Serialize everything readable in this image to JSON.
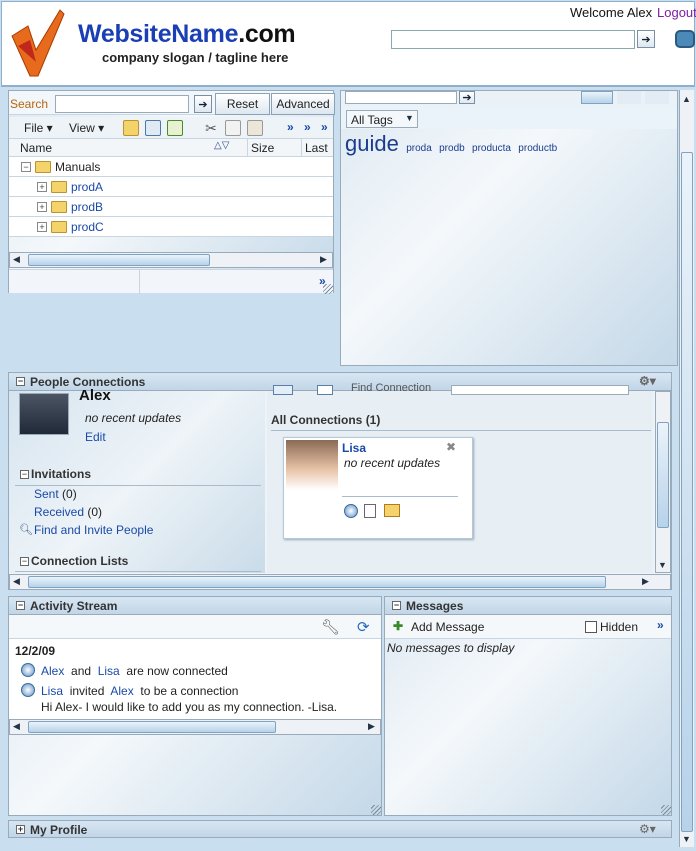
{
  "header": {
    "site_name_main": "WebsiteName",
    "site_name_tld": ".com",
    "tagline": "company slogan / tagline here",
    "welcome": "Welcome Alex",
    "logout": "Logout",
    "search_value": ""
  },
  "documents": {
    "search_label": "Search",
    "search_value": "",
    "reset_label": "Reset",
    "advanced_label": "Advanced",
    "file_menu": "File",
    "view_menu": "View",
    "columns": [
      "Name",
      "Size",
      "Last"
    ],
    "tree": [
      {
        "label": "Manuals",
        "expander": "−",
        "level": 0,
        "is_link": false
      },
      {
        "label": "prodA",
        "expander": "+",
        "level": 1,
        "is_link": true
      },
      {
        "label": "prodB",
        "expander": "+",
        "level": 1,
        "is_link": true
      },
      {
        "label": "prodC",
        "expander": "+",
        "level": 1,
        "is_link": true
      }
    ]
  },
  "tags": {
    "filter_value": "All Tags",
    "cloud": [
      {
        "label": "guide",
        "size": "large"
      },
      {
        "label": "proda",
        "size": "small"
      },
      {
        "label": "prodb",
        "size": "small"
      },
      {
        "label": "producta",
        "size": "small"
      },
      {
        "label": "productb",
        "size": "small"
      }
    ]
  },
  "people_connections": {
    "title": "People Connections",
    "user_name": "Alex",
    "user_status": "no recent updates",
    "edit_label": "Edit",
    "invitations_title": "Invitations",
    "sent_label": "Sent",
    "sent_count": "(0)",
    "received_label": "Received",
    "received_count": "(0)",
    "find_invite_label": "Find and Invite People",
    "connection_lists_title": "Connection Lists",
    "find_connection_label": "Find Connection",
    "all_connections_label": "All Connections",
    "all_connections_count": "(1)",
    "connection": {
      "name": "Lisa",
      "status": "no recent updates"
    }
  },
  "activity_stream": {
    "title": "Activity Stream",
    "date": "12/2/09",
    "items": [
      {
        "actor": "Alex",
        "w1": "and",
        "target": "Lisa",
        "w2": "are now connected"
      },
      {
        "actor": "Lisa",
        "w1": "invited",
        "target": "Alex",
        "w2": "to be a connection"
      }
    ],
    "message": "Hi Alex- I would like to add you as my connection. -Lisa."
  },
  "messages": {
    "title": "Messages",
    "add_label": "Add Message",
    "hidden_label": "Hidden",
    "empty_text": "No messages to display"
  },
  "my_profile": {
    "title": "My Profile"
  }
}
